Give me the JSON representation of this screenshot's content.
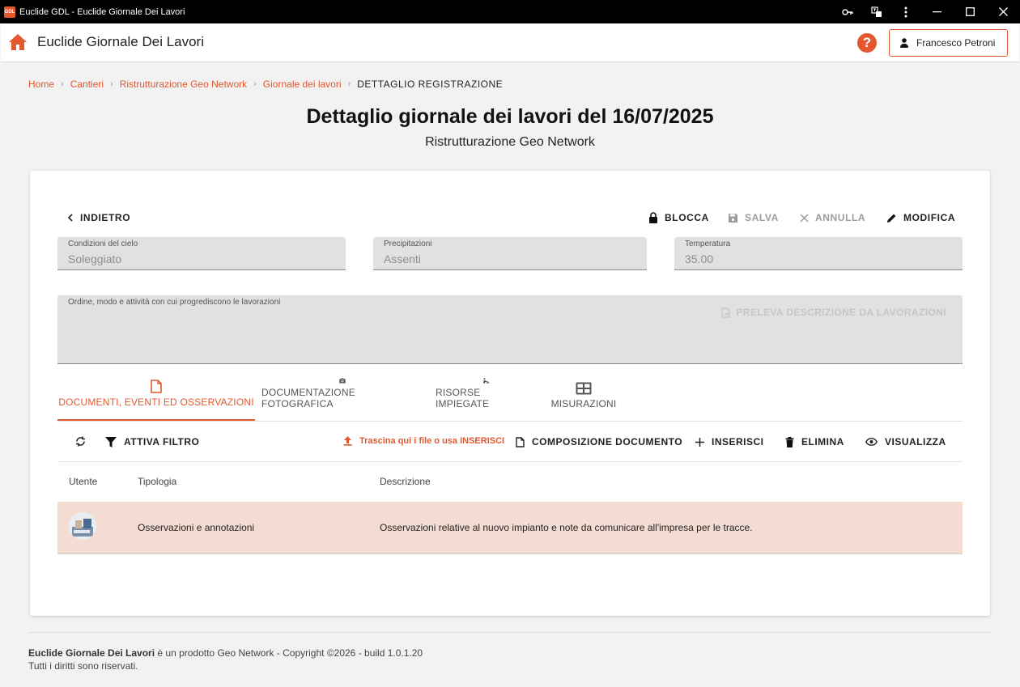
{
  "window": {
    "logo_text": "GDL",
    "title": "Euclide GDL - Euclide Giornale Dei Lavori"
  },
  "appbar": {
    "title": "Euclide Giornale Dei Lavori",
    "help_label": "?",
    "user_name": "Francesco Petroni"
  },
  "breadcrumb": {
    "items": [
      "Home",
      "Cantieri",
      "Ristrutturazione Geo Network",
      "Giornale dei lavori"
    ],
    "separator": "›",
    "current": "DETTAGLIO REGISTRAZIONE"
  },
  "page": {
    "title": "Dettaglio giornale dei lavori del 16/07/2025",
    "subtitle": "Ristrutturazione Geo Network"
  },
  "actions": {
    "back": "INDIETRO",
    "lock": "BLOCCA",
    "save": "SALVA",
    "cancel": "ANNULLA",
    "edit": "MODIFICA"
  },
  "fields": {
    "sky_label": "Condizioni del cielo",
    "sky_value": "Soleggiato",
    "rain_label": "Precipitazioni",
    "rain_value": "Assenti",
    "temp_label": "Temperatura",
    "temp_value": "35.00",
    "order_label": "Ordine, modo e attività con cui progrediscono le lavorazioni",
    "preleva": "PRELEVA DESCRIZIONE DA LAVORAZIONI"
  },
  "tabs": [
    {
      "label": "DOCUMENTI, EVENTI ED OSSERVAZIONI",
      "icon": "document-icon",
      "active": true
    },
    {
      "label": "DOCUMENTAZIONE FOTOGRAFICA",
      "icon": "camera-icon",
      "active": false
    },
    {
      "label": "RISORSE IMPIEGATE",
      "icon": "worker-icon",
      "active": false
    },
    {
      "label": "MISURAZIONI",
      "icon": "table-icon",
      "active": false
    }
  ],
  "toolbar": {
    "filter": "ATTIVA FILTRO",
    "upload": "Trascina qui i file o usa INSERISCI",
    "compose": "COMPOSIZIONE DOCUMENTO",
    "insert": "INSERISCI",
    "delete": "ELIMINA",
    "view": "VISUALIZZA"
  },
  "table": {
    "columns": [
      "Utente",
      "Tipologia",
      "Descrizione"
    ],
    "rows": [
      {
        "tipologia": "Osservazioni e annotazioni",
        "descrizione": "Osservazioni relative al nuovo impianto e note da comunicare all'impresa per le tracce."
      }
    ]
  },
  "footer": {
    "product": "Euclide Giornale Dei Lavori",
    "text": " è un prodotto Geo Network - Copyright ©2026 - build 1.0.1.20",
    "rights": "Tutti i diritti sono riservati."
  },
  "colors": {
    "accent": "#e3582e",
    "selected_row": "#f5dcd2",
    "field_bg": "#e1e1e1"
  }
}
